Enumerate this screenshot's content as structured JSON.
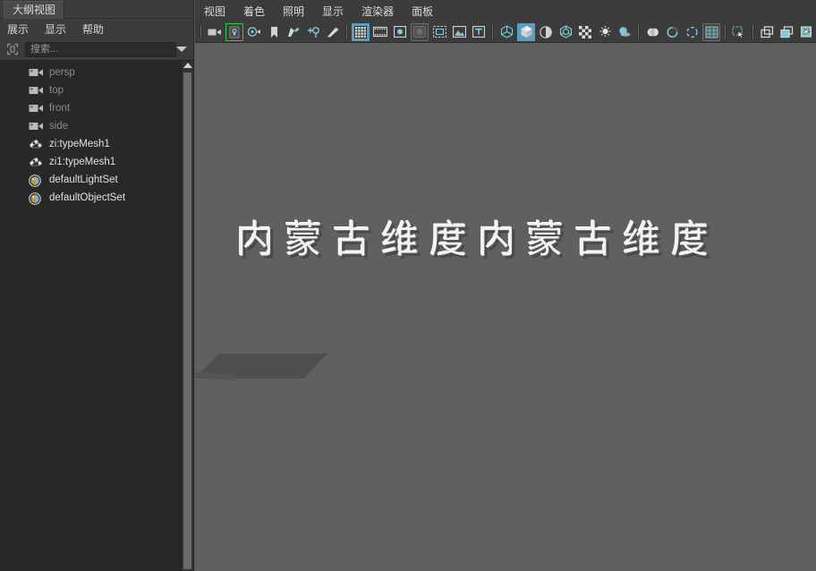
{
  "outliner": {
    "tab_label": "大纲视图",
    "menus": [
      "展示",
      "显示",
      "帮助"
    ],
    "filter_icon": "filter-icon",
    "search": {
      "placeholder": "搜索...",
      "value": "",
      "dropdown_icon": "chevron-down-icon"
    },
    "items": [
      {
        "label": "persp",
        "icon": "camera-icon",
        "style": "dim"
      },
      {
        "label": "top",
        "icon": "camera-icon",
        "style": "dim"
      },
      {
        "label": "front",
        "icon": "camera-icon",
        "style": "dim"
      },
      {
        "label": "side",
        "icon": "camera-icon",
        "style": "dim"
      },
      {
        "label": "zi:typeMesh1",
        "icon": "mesh-icon",
        "style": "bright"
      },
      {
        "label": "zi1:typeMesh1",
        "icon": "mesh-icon",
        "style": "bright"
      },
      {
        "label": "defaultLightSet",
        "icon": "set-icon",
        "style": "bright"
      },
      {
        "label": "defaultObjectSet",
        "icon": "set-icon",
        "style": "bright"
      }
    ],
    "scrollbar": {
      "up_arrow_icon": "scroll-up-icon"
    }
  },
  "viewport_panel": {
    "menus": [
      "视图",
      "着色",
      "照明",
      "显示",
      "渲染器",
      "面板"
    ],
    "toolbar": [
      {
        "name": "separator",
        "type": "sep"
      },
      {
        "name": "select-camera-icon",
        "type": "icon",
        "state": "normal"
      },
      {
        "name": "lock-camera-icon",
        "type": "icon",
        "state": "green"
      },
      {
        "name": "camera-attributes-icon",
        "type": "icon",
        "state": "normal"
      },
      {
        "name": "bookmark-icon",
        "type": "icon",
        "state": "normal"
      },
      {
        "name": "grease-pencil-icon",
        "type": "icon",
        "state": "normal"
      },
      {
        "name": "resolution-gate-icon",
        "type": "icon",
        "state": "normal"
      },
      {
        "name": "film-gate-icon",
        "type": "icon",
        "state": "normal"
      },
      {
        "name": "separator",
        "type": "sep"
      },
      {
        "name": "grid-toggle-icon",
        "type": "icon",
        "state": "on"
      },
      {
        "name": "film-gate-toggle-icon",
        "type": "icon",
        "state": "normal"
      },
      {
        "name": "field-chart-icon",
        "type": "icon",
        "state": "normal"
      },
      {
        "name": "safe-action-icon",
        "type": "icon",
        "state": "frame"
      },
      {
        "name": "safe-title-icon",
        "type": "icon",
        "state": "normal"
      },
      {
        "name": "image-plane-icon",
        "type": "icon",
        "state": "normal"
      },
      {
        "name": "text-toggle-icon",
        "type": "icon",
        "state": "normal"
      },
      {
        "name": "separator",
        "type": "sep"
      },
      {
        "name": "wireframe-icon",
        "type": "icon",
        "state": "normal"
      },
      {
        "name": "smooth-shade-icon",
        "type": "icon",
        "state": "on"
      },
      {
        "name": "flat-shade-icon",
        "type": "icon",
        "state": "normal"
      },
      {
        "name": "shaded-wireframe-icon",
        "type": "icon",
        "state": "normal"
      },
      {
        "name": "texture-toggle-icon",
        "type": "icon",
        "state": "normal"
      },
      {
        "name": "lighting-icon",
        "type": "icon",
        "state": "normal"
      },
      {
        "name": "shadows-icon",
        "type": "icon",
        "state": "normal"
      },
      {
        "name": "separator",
        "type": "sep"
      },
      {
        "name": "screen-space-ao-icon",
        "type": "icon",
        "state": "normal"
      },
      {
        "name": "motion-blur-icon",
        "type": "icon",
        "state": "normal"
      },
      {
        "name": "multisample-icon",
        "type": "icon",
        "state": "normal"
      },
      {
        "name": "depth-of-field-icon",
        "type": "icon",
        "state": "frame"
      },
      {
        "name": "separator",
        "type": "sep"
      },
      {
        "name": "isolate-select-icon",
        "type": "icon",
        "state": "normal"
      },
      {
        "name": "separator",
        "type": "sep"
      },
      {
        "name": "xray-icon",
        "type": "icon",
        "state": "normal"
      },
      {
        "name": "xray-joints-icon",
        "type": "icon",
        "state": "normal"
      },
      {
        "name": "xray-active-icon",
        "type": "icon",
        "state": "normal"
      }
    ],
    "scene": {
      "text_3d": "内蒙古维度内蒙古维度",
      "ground_plane": "ground-plane"
    }
  },
  "colors": {
    "panel_bg": "#3c3c3c",
    "list_bg": "#282828",
    "viewport_bg": "#606060",
    "accent_blue": "#5a9fc0",
    "accent_green": "#2ecc40",
    "text_bright": "#e2e2e2",
    "text_dim": "#8c8c8c"
  }
}
